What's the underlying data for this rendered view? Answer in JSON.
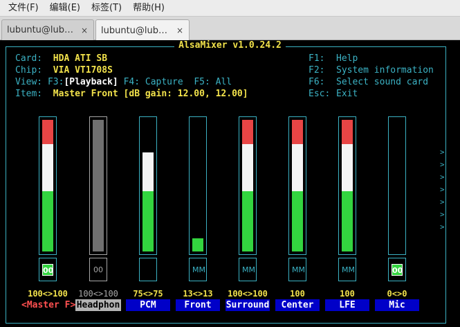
{
  "menu": [
    {
      "label": "文件(F)"
    },
    {
      "label": "编辑(E)"
    },
    {
      "label": "标签(T)"
    },
    {
      "label": "帮助(H)"
    }
  ],
  "tabs": [
    {
      "label": "lubuntu@lub…",
      "close": "×"
    },
    {
      "label": "lubuntu@lub…",
      "close": "×"
    }
  ],
  "mixer": {
    "title": "AlsaMixer v1.0.24.2",
    "card_label": "Card:",
    "card_value": "HDA ATI SB",
    "chip_label": "Chip:",
    "chip_value": "VIA VT1708S",
    "view_label": "View:",
    "view_f3": "F3:",
    "view_playback": "[Playback]",
    "view_capture": "F4: Capture",
    "view_all": "F5: All",
    "item_label": "Item:",
    "item_value": "Master Front [dB gain: 12.00, 12.00]",
    "help": [
      {
        "key": "F1:",
        "text": "Help"
      },
      {
        "key": "F2:",
        "text": "System information"
      },
      {
        "key": "F6:",
        "text": "Select sound card"
      },
      {
        "key": "Esc:",
        "text": "Exit"
      }
    ],
    "more_arrow": ">"
  },
  "channels": [
    {
      "name": "<Master F>",
      "volume": "100<>100",
      "level": 1.0,
      "mute": "00",
      "state": "selected"
    },
    {
      "name": "Headphon",
      "volume": "100<>100",
      "level": 1.0,
      "mute": "00",
      "state": "inactive"
    },
    {
      "name": "PCM",
      "volume": "75<>75",
      "level": 0.75,
      "mute": "",
      "state": "normal"
    },
    {
      "name": "Front",
      "volume": "13<>13",
      "level": 0.1,
      "mute": "MM",
      "state": "normal"
    },
    {
      "name": "Surround",
      "volume": "100<>100",
      "level": 1.0,
      "mute": "MM",
      "state": "normal"
    },
    {
      "name": "Center",
      "volume": "100",
      "level": 1.0,
      "mute": "MM",
      "state": "normal"
    },
    {
      "name": "LFE",
      "volume": "100",
      "level": 1.0,
      "mute": "MM",
      "state": "normal"
    },
    {
      "name": "Mic",
      "volume": "0<>0",
      "level": 0,
      "mute": "00",
      "state": "normal"
    }
  ],
  "colors": {
    "terminal_bg": "#000000",
    "frame": "#3bb2c4",
    "label_cyan": "#3bb2c4",
    "value_yellow": "#f2e24b",
    "bar_red": "#e84545",
    "bar_white": "#f4f4f4",
    "bar_green": "#33d43f",
    "channel_name_bg": "#0000c8"
  }
}
